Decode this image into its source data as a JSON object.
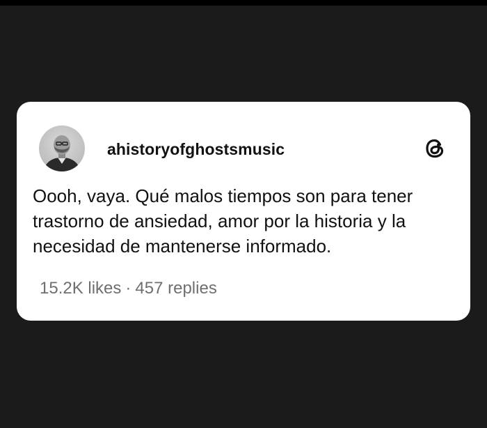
{
  "post": {
    "username": "ahistoryofghostsmusic",
    "text": "Oooh, vaya. Qué malos tiempos son para tener trastorno de ansiedad, amor por la historia y la necesidad de mantenerse informado.",
    "likes": "15.2K likes",
    "separator": "·",
    "replies": "457 replies"
  },
  "icons": {
    "avatar": "profile-photo",
    "platform": "threads-icon"
  },
  "colors": {
    "background": "#1b1b1b",
    "card": "#ffffff",
    "text": "#111111",
    "stats": "#6f6f6f"
  }
}
